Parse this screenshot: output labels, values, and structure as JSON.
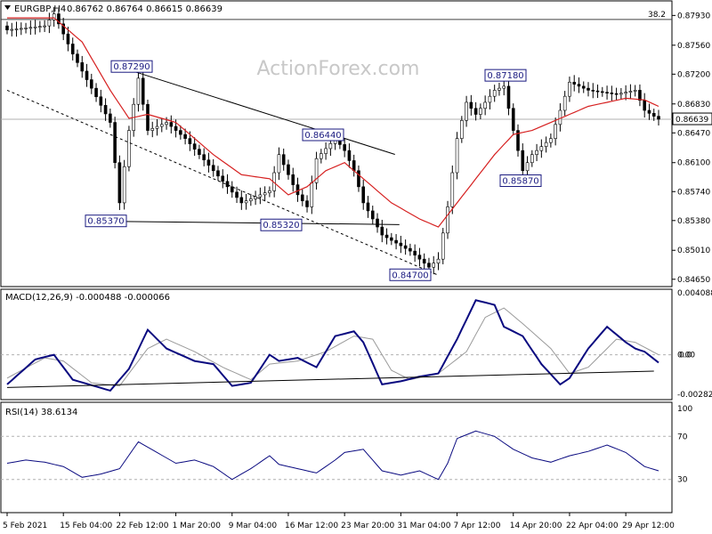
{
  "header": {
    "symbol": "EURGBP,H4",
    "ohlc": "0.86762 0.86764 0.86615 0.86639"
  },
  "watermark": "ActionForex.com",
  "price_panel": {
    "y_ticks": [
      "0.87930",
      "0.87560",
      "0.87200",
      "0.86830",
      "0.86470",
      "0.86100",
      "0.85740",
      "0.85380",
      "0.85010",
      "0.84650"
    ],
    "y_tick_values": [
      0.8793,
      0.8756,
      0.872,
      0.8683,
      0.8647,
      0.861,
      0.8574,
      0.8538,
      0.8501,
      0.8465
    ],
    "last_price": "0.86639",
    "last_price_value": 0.86639,
    "fib_label": "38.2",
    "fib_value": 0.8788,
    "price_labels": [
      {
        "text": "0.87290",
        "x": 22,
        "y": 0.8729
      },
      {
        "text": "0.85370",
        "x": 22,
        "y": 0.8537
      },
      {
        "text": "0.85320",
        "x": 55,
        "y": 0.8532
      },
      {
        "text": "0.86440",
        "x": 65,
        "y": 0.8644
      },
      {
        "text": "0.84700",
        "x": 80,
        "y": 0.847
      },
      {
        "text": "0.87180",
        "x": 98,
        "y": 0.8718
      },
      {
        "text": "0.85870",
        "x": 110,
        "y": 0.8587
      }
    ]
  },
  "macd_panel": {
    "title": "MACD(12,26,9) -0.000488 -0.000066",
    "y_ticks": [
      "0.004088",
      "0.00",
      "0.0",
      "-0.00282"
    ],
    "y_tick_values": [
      0.004088,
      0.0,
      0.0,
      -0.00282
    ]
  },
  "rsi_panel": {
    "title": "RSI(14) 38.6134",
    "y_ticks": [
      "100",
      "70",
      "30"
    ],
    "y_tick_values": [
      100,
      70,
      30
    ]
  },
  "x_ticks": [
    "5 Feb 2021",
    "15 Feb 04:00",
    "22 Feb 12:00",
    "1 Mar 20:00",
    "9 Mar 04:00",
    "16 Mar 12:00",
    "23 Mar 20:00",
    "31 Mar 04:00",
    "7 Apr 12:00",
    "14 Apr 20:00",
    "22 Apr 04:00",
    "29 Apr 12:00"
  ],
  "x_tick_index": [
    0,
    12,
    24,
    36,
    48,
    60,
    72,
    84,
    96,
    108,
    120,
    132
  ],
  "chart_data": [
    {
      "type": "candlestick",
      "title": "EURGBP,H4",
      "ylim": [
        0.8457,
        0.881
      ],
      "series": [
        {
          "name": "close",
          "x_count": 140,
          "anchors": [
            [
              0,
              0.8775
            ],
            [
              8,
              0.878
            ],
            [
              10,
              0.8795
            ],
            [
              14,
              0.8745
            ],
            [
              22,
              0.866
            ],
            [
              24,
              0.856
            ],
            [
              26,
              0.865
            ],
            [
              28,
              0.8715
            ],
            [
              30,
              0.865
            ],
            [
              34,
              0.866
            ],
            [
              38,
              0.864
            ],
            [
              44,
              0.86
            ],
            [
              50,
              0.856
            ],
            [
              56,
              0.8575
            ],
            [
              58,
              0.862
            ],
            [
              62,
              0.857
            ],
            [
              64,
              0.8555
            ],
            [
              66,
              0.8615
            ],
            [
              70,
              0.864
            ],
            [
              72,
              0.8625
            ],
            [
              74,
              0.86
            ],
            [
              76,
              0.856
            ],
            [
              80,
              0.852
            ],
            [
              86,
              0.85
            ],
            [
              90,
              0.848
            ],
            [
              92,
              0.849
            ],
            [
              94,
              0.8555
            ],
            [
              96,
              0.864
            ],
            [
              98,
              0.8685
            ],
            [
              100,
              0.867
            ],
            [
              104,
              0.87
            ],
            [
              106,
              0.8705
            ],
            [
              108,
              0.865
            ],
            [
              110,
              0.86
            ],
            [
              112,
              0.862
            ],
            [
              116,
              0.864
            ],
            [
              120,
              0.871
            ],
            [
              124,
              0.87
            ],
            [
              130,
              0.8695
            ],
            [
              134,
              0.87
            ],
            [
              136,
              0.8675
            ],
            [
              139,
              0.8664
            ]
          ]
        },
        {
          "name": "moving average",
          "x_count": 140,
          "anchors": [
            [
              0,
              0.879
            ],
            [
              10,
              0.879
            ],
            [
              16,
              0.876
            ],
            [
              22,
              0.87
            ],
            [
              26,
              0.8665
            ],
            [
              30,
              0.867
            ],
            [
              36,
              0.866
            ],
            [
              44,
              0.862
            ],
            [
              50,
              0.8595
            ],
            [
              56,
              0.859
            ],
            [
              60,
              0.857
            ],
            [
              64,
              0.858
            ],
            [
              68,
              0.86
            ],
            [
              72,
              0.861
            ],
            [
              76,
              0.859
            ],
            [
              82,
              0.856
            ],
            [
              88,
              0.854
            ],
            [
              92,
              0.853
            ],
            [
              96,
              0.856
            ],
            [
              100,
              0.859
            ],
            [
              104,
              0.862
            ],
            [
              108,
              0.8645
            ],
            [
              112,
              0.865
            ],
            [
              116,
              0.866
            ],
            [
              120,
              0.867
            ],
            [
              124,
              0.868
            ],
            [
              128,
              0.8685
            ],
            [
              132,
              0.869
            ],
            [
              136,
              0.8688
            ],
            [
              139,
              0.868
            ]
          ]
        }
      ],
      "trendlines": [
        {
          "from": [
            24,
            0.8729
          ],
          "to": [
            78,
            0.8618
          ]
        },
        {
          "from": [
            0,
            0.87
          ],
          "to": [
            92,
            0.847
          ]
        },
        {
          "from": [
            22,
            0.8537
          ],
          "to": [
            78,
            0.8533
          ]
        }
      ],
      "reference_lines": [
        {
          "label": "38.2",
          "value": 0.8788
        },
        {
          "label": "0.86639",
          "value": 0.86639
        }
      ]
    },
    {
      "type": "line",
      "title": "MACD(12,26,9) -0.000488 -0.000066",
      "ylim": [
        -0.00282,
        0.004088
      ],
      "series": [
        {
          "name": "MACD",
          "x_count": 140,
          "anchors": [
            [
              0,
              -0.0019
            ],
            [
              6,
              -0.0003
            ],
            [
              10,
              0.0
            ],
            [
              14,
              -0.0016
            ],
            [
              22,
              -0.0023
            ],
            [
              26,
              -0.0009
            ],
            [
              30,
              0.0016
            ],
            [
              34,
              0.0004
            ],
            [
              40,
              -0.0004
            ],
            [
              44,
              -0.0006
            ],
            [
              48,
              -0.002
            ],
            [
              52,
              -0.0018
            ],
            [
              56,
              0.0
            ],
            [
              58,
              -0.0004
            ],
            [
              62,
              -0.0002
            ],
            [
              66,
              -0.0008
            ],
            [
              70,
              0.0012
            ],
            [
              74,
              0.0015
            ],
            [
              76,
              0.0008
            ],
            [
              80,
              -0.0019
            ],
            [
              84,
              -0.0017
            ],
            [
              88,
              -0.0014
            ],
            [
              92,
              -0.0012
            ],
            [
              96,
              0.001
            ],
            [
              100,
              0.0035
            ],
            [
              104,
              0.0032
            ],
            [
              106,
              0.0018
            ],
            [
              110,
              0.0012
            ],
            [
              114,
              -0.0006
            ],
            [
              118,
              -0.0019
            ],
            [
              120,
              -0.0015
            ],
            [
              124,
              0.0004
            ],
            [
              128,
              0.0018
            ],
            [
              132,
              0.0008
            ],
            [
              134,
              0.0004
            ],
            [
              136,
              0.0002
            ],
            [
              139,
              -0.0005
            ]
          ]
        },
        {
          "name": "signal",
          "x_count": 140,
          "anchors": [
            [
              0,
              -0.0015
            ],
            [
              8,
              -0.0002
            ],
            [
              12,
              -0.0004
            ],
            [
              18,
              -0.0018
            ],
            [
              24,
              -0.002
            ],
            [
              30,
              0.0004
            ],
            [
              34,
              0.001
            ],
            [
              40,
              0.0002
            ],
            [
              46,
              -0.0008
            ],
            [
              52,
              -0.0016
            ],
            [
              56,
              -0.0006
            ],
            [
              62,
              -0.0004
            ],
            [
              68,
              0.0002
            ],
            [
              74,
              0.0012
            ],
            [
              78,
              0.001
            ],
            [
              82,
              -0.001
            ],
            [
              86,
              -0.0016
            ],
            [
              92,
              -0.0012
            ],
            [
              98,
              0.0002
            ],
            [
              102,
              0.0024
            ],
            [
              106,
              0.003
            ],
            [
              110,
              0.002
            ],
            [
              116,
              0.0004
            ],
            [
              120,
              -0.0012
            ],
            [
              124,
              -0.0008
            ],
            [
              130,
              0.001
            ],
            [
              134,
              0.0008
            ],
            [
              139,
              0.0
            ]
          ]
        }
      ],
      "trendline": {
        "from": [
          0,
          -0.0021
        ],
        "to": [
          138,
          -0.00105
        ]
      }
    },
    {
      "type": "line",
      "title": "RSI(14) 38.6134",
      "ylim": [
        0,
        100
      ],
      "series": [
        {
          "name": "RSI",
          "x_count": 140,
          "anchors": [
            [
              0,
              45
            ],
            [
              4,
              48
            ],
            [
              8,
              46
            ],
            [
              12,
              42
            ],
            [
              16,
              32
            ],
            [
              20,
              35
            ],
            [
              24,
              40
            ],
            [
              28,
              65
            ],
            [
              32,
              55
            ],
            [
              36,
              45
            ],
            [
              40,
              48
            ],
            [
              44,
              42
            ],
            [
              48,
              30
            ],
            [
              52,
              40
            ],
            [
              56,
              52
            ],
            [
              58,
              44
            ],
            [
              62,
              40
            ],
            [
              66,
              36
            ],
            [
              70,
              48
            ],
            [
              72,
              55
            ],
            [
              76,
              58
            ],
            [
              80,
              38
            ],
            [
              84,
              34
            ],
            [
              88,
              38
            ],
            [
              92,
              30
            ],
            [
              94,
              45
            ],
            [
              96,
              68
            ],
            [
              100,
              75
            ],
            [
              104,
              70
            ],
            [
              108,
              58
            ],
            [
              112,
              50
            ],
            [
              116,
              46
            ],
            [
              120,
              52
            ],
            [
              124,
              56
            ],
            [
              128,
              62
            ],
            [
              132,
              55
            ],
            [
              136,
              42
            ],
            [
              139,
              38
            ]
          ]
        }
      ]
    }
  ]
}
